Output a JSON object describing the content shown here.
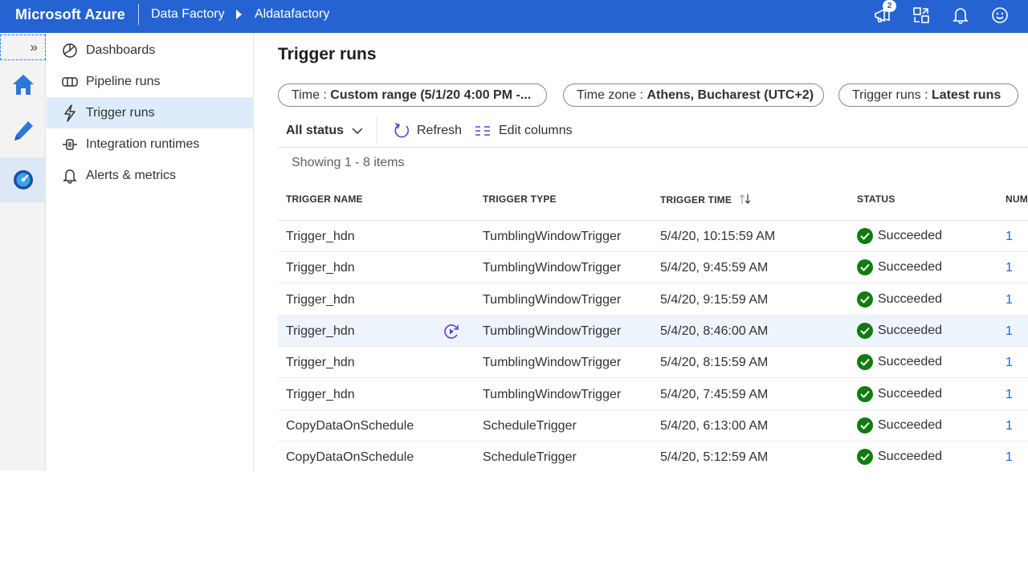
{
  "topbar": {
    "brand": "Microsoft Azure",
    "breadcrumb": [
      "Data Factory",
      "Aldatafactory"
    ],
    "notification_count": "2",
    "icons": [
      "feedback-icon",
      "directory-switch-icon",
      "bell-icon",
      "smiley-icon"
    ]
  },
  "rail": {
    "expand_label": "»",
    "items": [
      {
        "name": "home-icon",
        "active": false
      },
      {
        "name": "pencil-icon",
        "active": false
      },
      {
        "name": "monitor-icon",
        "active": true
      }
    ]
  },
  "nav": {
    "items": [
      {
        "label": "Dashboards",
        "icon": "dashboard-icon",
        "active": false
      },
      {
        "label": "Pipeline runs",
        "icon": "pipeline-icon",
        "active": false
      },
      {
        "label": "Trigger runs",
        "icon": "trigger-icon",
        "active": true
      },
      {
        "label": "Integration runtimes",
        "icon": "integration-runtime-icon",
        "active": false
      },
      {
        "label": "Alerts & metrics",
        "icon": "bell-icon",
        "active": false
      }
    ]
  },
  "main": {
    "title": "Trigger runs",
    "filters": [
      {
        "key": "Time : ",
        "value": "Custom range (5/1/20 4:00 PM -..."
      },
      {
        "key": "Time zone : ",
        "value": "Athens, Bucharest (UTC+2)"
      },
      {
        "key": "Trigger runs : ",
        "value": "Latest runs"
      }
    ],
    "status_filter": "All status",
    "refresh_label": "Refresh",
    "edit_columns_label": "Edit columns",
    "showing": "Showing 1 - 8 items",
    "columns": [
      "TRIGGER NAME",
      "TRIGGER TYPE",
      "TRIGGER TIME",
      "STATUS",
      "NUM"
    ],
    "rows": [
      {
        "name": "Trigger_hdn",
        "type": "TumblingWindowTrigger",
        "time": "5/4/20, 10:15:59 AM",
        "status": "Succeeded",
        "num": "1"
      },
      {
        "name": "Trigger_hdn",
        "type": "TumblingWindowTrigger",
        "time": "5/4/20, 9:45:59 AM",
        "status": "Succeeded",
        "num": "1"
      },
      {
        "name": "Trigger_hdn",
        "type": "TumblingWindowTrigger",
        "time": "5/4/20, 9:15:59 AM",
        "status": "Succeeded",
        "num": "1"
      },
      {
        "name": "Trigger_hdn",
        "type": "TumblingWindowTrigger",
        "time": "5/4/20, 8:46:00 AM",
        "status": "Succeeded",
        "num": "1",
        "hover": true
      },
      {
        "name": "Trigger_hdn",
        "type": "TumblingWindowTrigger",
        "time": "5/4/20, 8:15:59 AM",
        "status": "Succeeded",
        "num": "1"
      },
      {
        "name": "Trigger_hdn",
        "type": "TumblingWindowTrigger",
        "time": "5/4/20, 7:45:59 AM",
        "status": "Succeeded",
        "num": "1"
      },
      {
        "name": "CopyDataOnSchedule",
        "type": "ScheduleTrigger",
        "time": "5/4/20, 6:13:00 AM",
        "status": "Succeeded",
        "num": "1"
      },
      {
        "name": "CopyDataOnSchedule",
        "type": "ScheduleTrigger",
        "time": "5/4/20, 5:12:59 AM",
        "status": "Succeeded",
        "num": "1"
      }
    ]
  },
  "colors": {
    "accent": "#2463d1",
    "success": "#107c10",
    "rerun": "#5b3fd6"
  }
}
